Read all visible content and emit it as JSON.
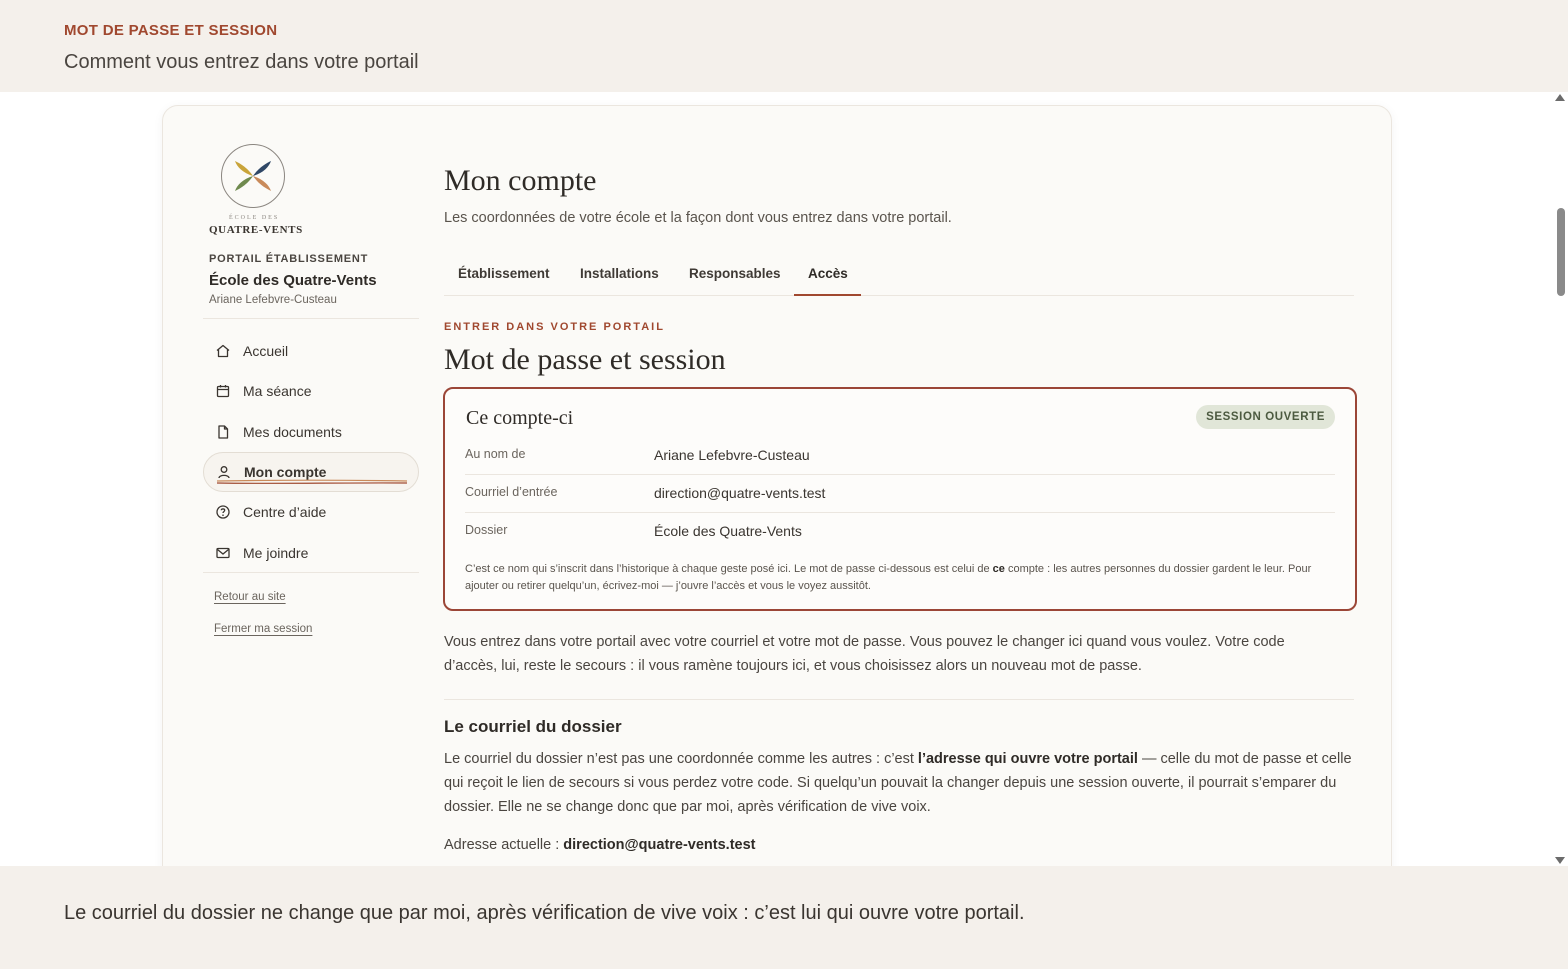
{
  "banner": {
    "eyebrow": "MOT DE PASSE ET SESSION",
    "subtitle": "Comment vous entrez dans votre portail"
  },
  "sidebar": {
    "logo_small": "ÉCOLE DES",
    "logo_name": "QUATRE-VENTS",
    "portal_label": "PORTAIL ÉTABLISSEMENT",
    "school": "École des Quatre-Vents",
    "user": "Ariane Lefebvre-Custeau",
    "items": [
      {
        "label": "Accueil",
        "icon": "home-icon"
      },
      {
        "label": "Ma séance",
        "icon": "calendar-icon"
      },
      {
        "label": "Mes documents",
        "icon": "document-icon"
      },
      {
        "label": "Mon compte",
        "icon": "user-icon",
        "active": true
      },
      {
        "label": "Centre d’aide",
        "icon": "help-icon"
      },
      {
        "label": "Me joindre",
        "icon": "mail-icon"
      }
    ],
    "links": [
      "Retour au site",
      "Fermer ma session"
    ]
  },
  "main": {
    "title": "Mon compte",
    "subtitle": "Les coordonnées de votre école et la façon dont vous entrez dans votre portail.",
    "tabs": [
      "Établissement",
      "Installations",
      "Responsables",
      "Accès"
    ],
    "active_tab": "Accès",
    "eyebrow": "ENTRER DANS VOTRE PORTAIL",
    "section_title": "Mot de passe et session",
    "account": {
      "title": "Ce compte-ci",
      "badge": "SESSION OUVERTE",
      "rows": [
        {
          "key": "Au nom de",
          "value": "Ariane Lefebvre-Custeau"
        },
        {
          "key": "Courriel d’entrée",
          "value": "direction@quatre-vents.test"
        },
        {
          "key": "Dossier",
          "value": "École des Quatre-Vents"
        }
      ],
      "note_a": "C’est ce nom qui s’inscrit dans l’historique à chaque geste posé ici. Le mot de passe ci-dessous est celui de ",
      "note_b": "ce",
      "note_c": " compte : les autres personnes du dossier gardent le leur. Pour ajouter ou retirer quelqu’un, écrivez-moi — j’ouvre l’accès et vous le voyez aussitôt."
    },
    "intro": "Vous entrez dans votre portail avec votre courriel et votre mot de passe. Vous pouvez le changer ici quand vous voulez. Votre code d’accès, lui, reste le secours : il vous ramène toujours ici, et vous choisissez alors un nouveau mot de passe.",
    "email_section": {
      "title": "Le courriel du dossier",
      "para_a": "Le courriel du dossier n’est pas une coordonnée comme les autres : c’est ",
      "para_b": "l’adresse qui ouvre votre portail",
      "para_c": " — celle du mot de passe et celle qui reçoit le lien de secours si vous perdez votre code. Si quelqu’un pouvait la changer depuis une session ouverte, il pourrait s’emparer du dossier. Elle ne se change donc que par moi, après vérification de vive voix.",
      "current_label": "Adresse actuelle : ",
      "current_value": "direction@quatre-vents.test"
    }
  },
  "footer": {
    "caption": "Le courriel du dossier ne change que par moi, après vérification de vive voix : c’est lui qui ouvre votre portail."
  },
  "colors": {
    "accent": "#a0482f",
    "badge_bg": "#e1e6d8",
    "banner_bg": "#f4f0eb"
  }
}
